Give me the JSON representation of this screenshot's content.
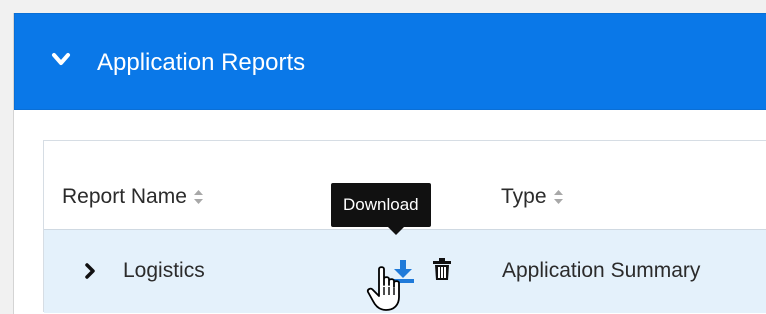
{
  "section": {
    "title": "Application Reports",
    "accent_color": "#0a78e8",
    "expand_icon": "chevron-down-icon"
  },
  "table": {
    "columns": [
      {
        "label": "Report Name",
        "sort_icon": "sort-icon"
      },
      {
        "label": "Type",
        "sort_icon": "sort-icon"
      }
    ],
    "rows": [
      {
        "name": "Logistics",
        "type": "Application Summary",
        "expand_icon": "chevron-right-icon",
        "actions": [
          "download-icon",
          "trash-icon"
        ]
      }
    ],
    "row_highlight_color": "#e4f1fb"
  },
  "tooltip": {
    "text": "Download"
  },
  "cursor": "hand-pointer-icon"
}
